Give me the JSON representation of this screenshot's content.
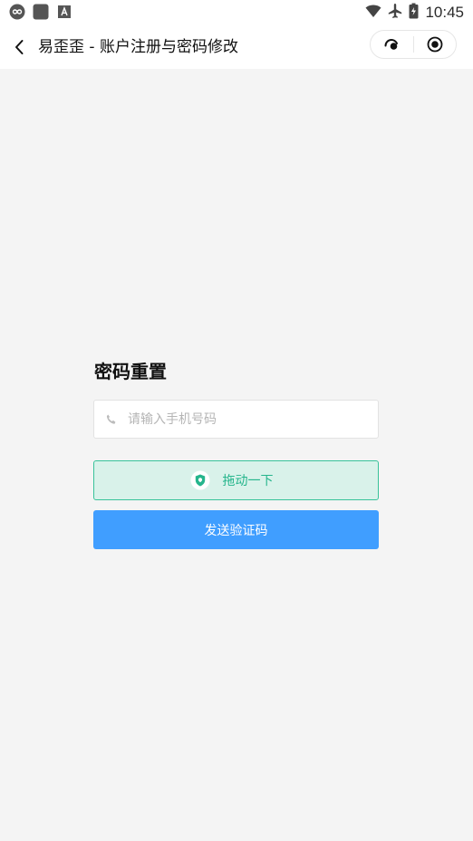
{
  "status_bar": {
    "time": "10:45",
    "icons": [
      "infinity-icon",
      "app-square-icon",
      "font-a-icon",
      "wifi-icon",
      "airplane-icon",
      "battery-charging-icon"
    ]
  },
  "nav": {
    "title": "易歪歪 - 账户注册与密码修改",
    "back_icon": "chevron-left-icon",
    "capsule_icons": [
      "more-dots-icon",
      "close-target-icon"
    ]
  },
  "form": {
    "title": "密码重置",
    "phone_placeholder": "请输入手机号码",
    "phone_value": "",
    "slider_label": "拖动一下",
    "send_label": "发送验证码"
  },
  "colors": {
    "background": "#f4f4f4",
    "primary": "#409eff",
    "slider_border": "#38c39a",
    "slider_bg": "#d9f2ea",
    "slider_text": "#25b58c"
  }
}
